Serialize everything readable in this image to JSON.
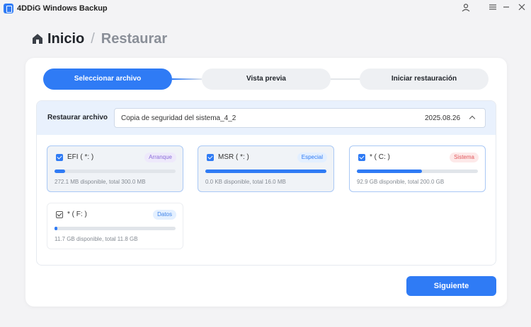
{
  "app": {
    "title": "4DDiG Windows Backup"
  },
  "window_controls": [
    "user-icon",
    "menu-icon",
    "minimize-icon",
    "close-icon"
  ],
  "breadcrumb": {
    "home": "Inicio",
    "separator": "/",
    "current": "Restaurar"
  },
  "steps": [
    {
      "label": "Seleccionar archivo",
      "active": true
    },
    {
      "label": "Vista previa",
      "active": false
    },
    {
      "label": "Iniciar restauración",
      "active": false
    }
  ],
  "restore": {
    "label": "Restaurar archivo",
    "backup_name": "Copia de seguridad del sistema_4_2",
    "backup_date": "2025.08.26"
  },
  "partitions": [
    {
      "name": "EFI ( *: )",
      "tag": "Arranque",
      "info": "272.1 MB disponible, total 300.0 MB",
      "used_fraction": 0.09,
      "checked": true
    },
    {
      "name": "MSR ( *: )",
      "tag": "Especial",
      "info": "0.0 KB disponible, total 16.0 MB",
      "used_fraction": 1.0,
      "checked": true
    },
    {
      "name": "* ( C: )",
      "tag": "Sistema",
      "info": "92.9 GB disponible, total 200.0 GB",
      "used_fraction": 0.54,
      "checked": true
    },
    {
      "name": "* ( F: )",
      "tag": "Datos",
      "info": "11.7 GB disponible, total 11.8 GB",
      "used_fraction": 0.01,
      "checked": true
    }
  ],
  "colors": {
    "accent": "#2f7bf5",
    "background": "#f3f3f5"
  },
  "actions": {
    "next": "Siguiente"
  }
}
